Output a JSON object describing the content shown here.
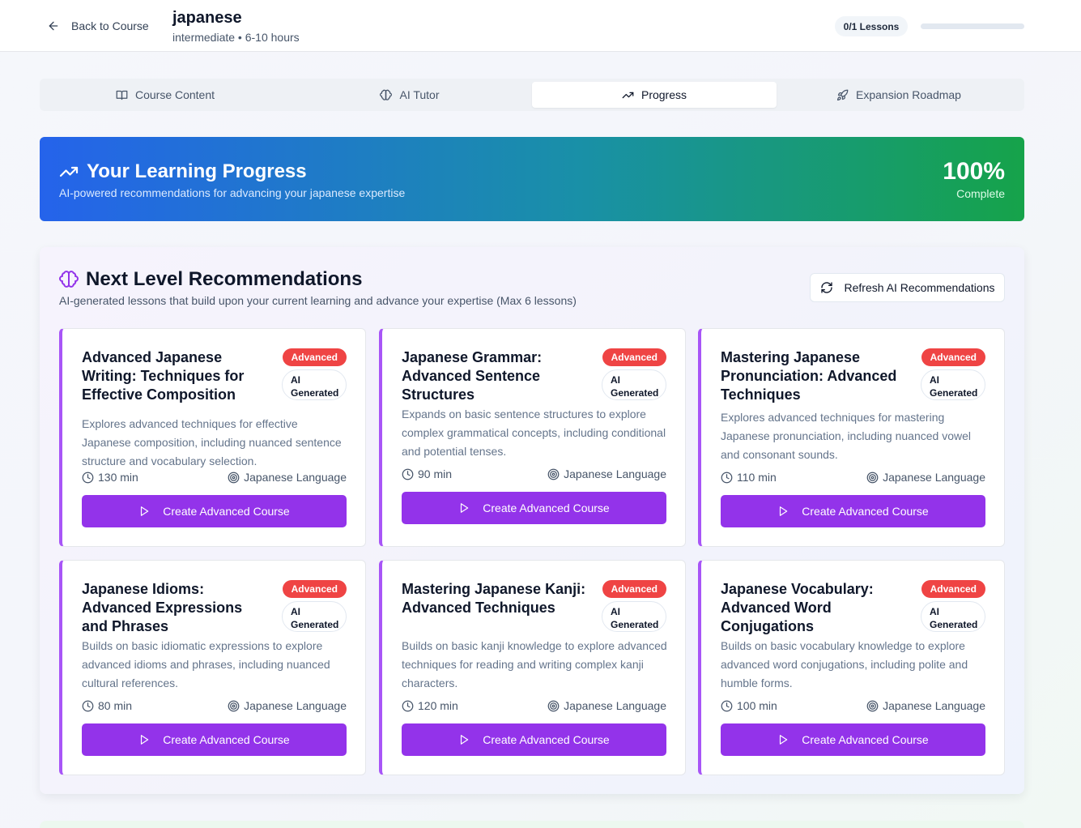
{
  "header": {
    "back_label": "Back to Course",
    "course_title": "japanese",
    "course_meta": "intermediate • 6-10 hours",
    "lessons_pill": "0/1 Lessons",
    "lessons_progress": 0
  },
  "tabs": [
    {
      "label": "Course Content",
      "icon": "book-open-icon"
    },
    {
      "label": "AI Tutor",
      "icon": "brain-icon"
    },
    {
      "label": "Progress",
      "icon": "trending-up-icon",
      "active": true
    },
    {
      "label": "Expansion Roadmap",
      "icon": "rocket-icon"
    }
  ],
  "hero": {
    "title": "Your Learning Progress",
    "subtitle": "AI-powered recommendations for advancing your japanese expertise",
    "percent": "100%",
    "percent_label": "Complete"
  },
  "recommendations": {
    "title": "Next Level Recommendations",
    "subtitle": "AI-generated lessons that build upon your current learning and advance your expertise (Max 6 lessons)",
    "refresh_label": "Refresh AI Recommendations",
    "cards": [
      {
        "title": "Advanced Japanese Writing: Techniques for Effective Composition",
        "level": "Advanced",
        "ai_badge": "AI Generated",
        "description": "Explores advanced techniques for effective Japanese composition, including nuanced sentence structure and vocabulary selection.",
        "duration": "130 min",
        "category": "Japanese Language",
        "button": "Create Advanced Course"
      },
      {
        "title": "Japanese Grammar: Advanced Sentence Structures",
        "level": "Advanced",
        "ai_badge": "AI Generated",
        "description": "Expands on basic sentence structures to explore complex grammatical concepts, including conditional and potential tenses.",
        "duration": "90 min",
        "category": "Japanese Language",
        "button": "Create Advanced Course"
      },
      {
        "title": "Mastering Japanese Pronunciation: Advanced Techniques",
        "level": "Advanced",
        "ai_badge": "AI Generated",
        "description": "Explores advanced techniques for mastering Japanese pronunciation, including nuanced vowel and consonant sounds.",
        "duration": "110 min",
        "category": "Japanese Language",
        "button": "Create Advanced Course"
      },
      {
        "title": "Japanese Idioms: Advanced Expressions and Phrases",
        "level": "Advanced",
        "ai_badge": "AI Generated",
        "description": "Builds on basic idiomatic expressions to explore advanced idioms and phrases, including nuanced cultural references.",
        "duration": "80 min",
        "category": "Japanese Language",
        "button": "Create Advanced Course"
      },
      {
        "title": "Mastering Japanese Kanji: Advanced Techniques",
        "level": "Advanced",
        "ai_badge": "AI Generated",
        "description": "Builds on basic kanji knowledge to explore advanced techniques for reading and writing complex kanji characters.",
        "duration": "120 min",
        "category": "Japanese Language",
        "button": "Create Advanced Course"
      },
      {
        "title": "Japanese Vocabulary: Advanced Word Conjugations",
        "level": "Advanced",
        "ai_badge": "AI Generated",
        "description": "Builds on basic vocabulary knowledge to explore advanced word conjugations, including polite and humble forms.",
        "duration": "100 min",
        "category": "Japanese Language",
        "button": "Create Advanced Course"
      }
    ]
  },
  "colors": {
    "accent_purple": "#9333ea",
    "badge_red": "#ef4444",
    "hero_start": "#2563eb",
    "hero_end": "#16a34a"
  }
}
